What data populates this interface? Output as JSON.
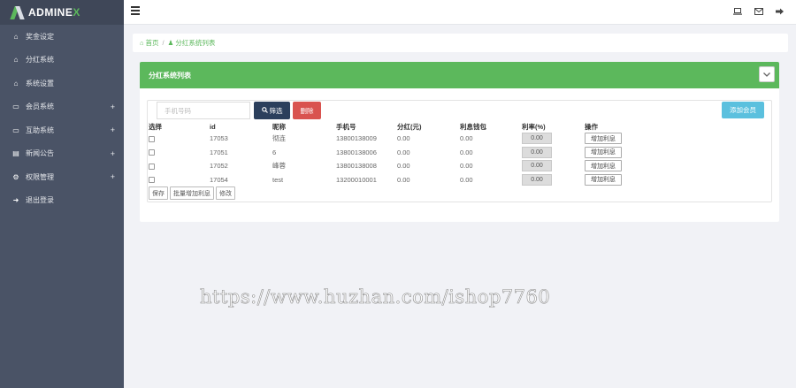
{
  "brand": {
    "name_main": "ADMINE",
    "name_accent": "X"
  },
  "sidebar": {
    "items": [
      {
        "icon": "home-icon",
        "glyph": "⌂",
        "label": "奖金设定",
        "expandable": false
      },
      {
        "icon": "home-icon",
        "glyph": "⌂",
        "label": "分红系统",
        "expandable": false
      },
      {
        "icon": "home-icon",
        "glyph": "⌂",
        "label": "系统设置",
        "expandable": false
      },
      {
        "icon": "laptop-icon",
        "glyph": "▭",
        "label": "会员系统",
        "expandable": true
      },
      {
        "icon": "laptop-icon",
        "glyph": "▭",
        "label": "互助系统",
        "expandable": true
      },
      {
        "icon": "newspaper-icon",
        "glyph": "▤",
        "label": "新闻公告",
        "expandable": true
      },
      {
        "icon": "cogs-icon",
        "glyph": "⚙",
        "label": "权限管理",
        "expandable": true
      },
      {
        "icon": "sign-out-icon",
        "glyph": "➜",
        "label": "退出登录",
        "expandable": false
      }
    ],
    "plus_glyph": "+"
  },
  "breadcrumb": {
    "home": "首页",
    "separator": "/",
    "current": "分红系统列表"
  },
  "panel": {
    "title": "分红系统列表"
  },
  "toolbar": {
    "search_placeholder": "手机号码",
    "search_label": "筛选",
    "delete_label": "删除",
    "add_label": "添加会员"
  },
  "table": {
    "headers": [
      "选择",
      "id",
      "昵称",
      "手机号",
      "分红(元)",
      "利息钱包",
      "利率(%)",
      "操作"
    ],
    "rows": [
      {
        "id": "17053",
        "nickname": "彻连",
        "phone": "13800138009",
        "dividend": "0.00",
        "wallet": "0.00",
        "rate": "0.00",
        "action": "增加利息"
      },
      {
        "id": "17051",
        "nickname": "6",
        "phone": "13800138006",
        "dividend": "0.00",
        "wallet": "0.00",
        "rate": "0.00",
        "action": "增加利息"
      },
      {
        "id": "17052",
        "nickname": "峰蓉",
        "phone": "13800138008",
        "dividend": "0.00",
        "wallet": "0.00",
        "rate": "0.00",
        "action": "增加利息"
      },
      {
        "id": "17054",
        "nickname": "test",
        "phone": "13200010001",
        "dividend": "0.00",
        "wallet": "0.00",
        "rate": "0.00",
        "action": "增加利息"
      }
    ]
  },
  "bottom": {
    "save": "保存",
    "batch_add": "批量增加利息",
    "edit": "修改"
  },
  "watermark": "https://www.huzhan.com/ishop7760",
  "colors": {
    "sidebar": "#4a5366",
    "accent": "#5cb85c",
    "primary_dark": "#2b3f5c",
    "danger": "#d9534f",
    "info": "#5bc0de"
  }
}
